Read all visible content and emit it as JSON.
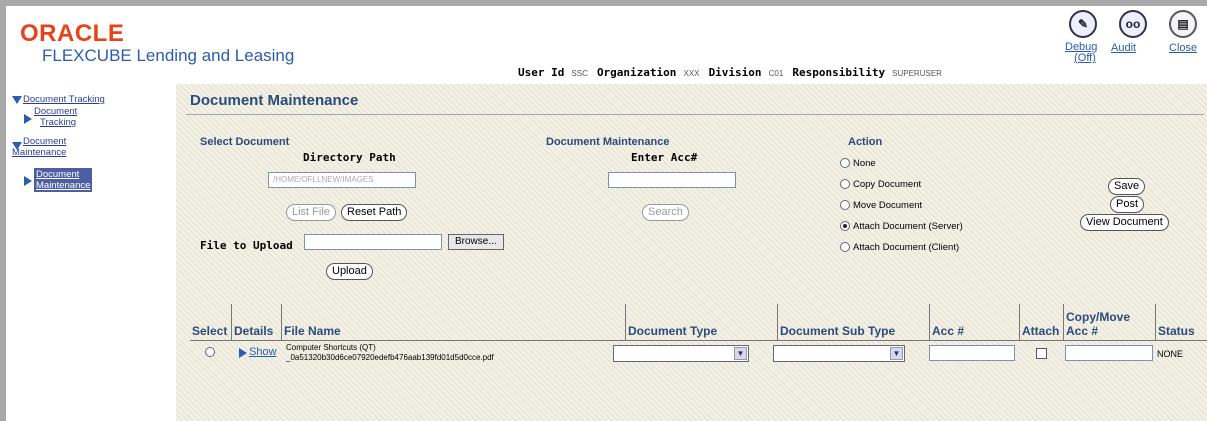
{
  "header": {
    "logo": "ORACLE",
    "product": "FLEXCUBE Lending and Leasing",
    "user_id_label": "User Id",
    "user_id": "SSC",
    "org_label": "Organization",
    "org": "XXX",
    "division_label": "Division",
    "division": "C01",
    "responsibility_label": "Responsibility",
    "responsibility": "SUPERUSER",
    "links": {
      "debug": "Debug",
      "debug_state": "(Off)",
      "audit": "Audit",
      "close": "Close"
    }
  },
  "nav": {
    "tracking_group": "Document Tracking",
    "tracking_item_1": "Document",
    "tracking_item_2": "Tracking",
    "maint_group_1": "Document",
    "maint_group_2": "Maintenance",
    "maint_item_1": "Document",
    "maint_item_2": "Maintenance"
  },
  "page": {
    "title": "Document Maintenance"
  },
  "select_document": {
    "title": "Select Document",
    "dir_label": "Directory Path",
    "dir_value": "/HOME/OFLLNEW/IMAGES",
    "list_file_button": "List File",
    "reset_path_button": "Reset Path",
    "upload_label": "File to Upload",
    "upload_value": "",
    "browse_button": "Browse...",
    "upload_button": "Upload"
  },
  "doc_maint": {
    "title": "Document Maintenance",
    "acc_label": "Enter Acc#",
    "acc_value": "",
    "search_button": "Search"
  },
  "action": {
    "title": "Action",
    "options": [
      "None",
      "Copy Document",
      "Move Document",
      "Attach Document (Server)",
      "Attach Document (Client)"
    ],
    "selected": "Attach Document (Server)",
    "save_button": "Save",
    "post_button": "Post",
    "view_button": "View Document"
  },
  "table": {
    "columns": [
      "Select",
      "Details",
      "File Name",
      "Document Type",
      "Document Sub Type",
      "Acc #",
      "Attach",
      "Copy/Move",
      "Acc #",
      "Status"
    ],
    "row": {
      "show_link": "Show",
      "file_line_1": "Computer Shortcuts (QT)",
      "file_line_2": "_0a51320b30d6ce07920edefb476aab139fd01d5d0cce.pdf",
      "doc_type": "",
      "doc_sub_type": "",
      "acc": "",
      "copy_move_acc": "",
      "status": "NONE"
    }
  }
}
